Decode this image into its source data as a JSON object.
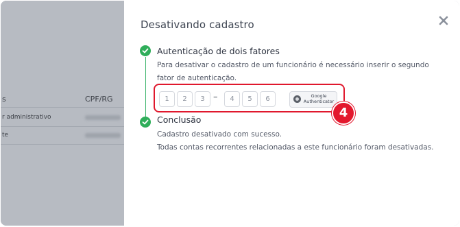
{
  "background": {
    "table": {
      "headers": [
        "s",
        "CPF/RG"
      ],
      "rows": [
        {
          "role": "r administrativo"
        },
        {
          "role": "te"
        }
      ]
    }
  },
  "modal": {
    "title": "Desativando cadastro",
    "close_icon": "close-icon",
    "steps": [
      {
        "title": "Autenticação de dois fatores",
        "description": "Para desativar o cadastro de um funcionário é necessário inserir o segundo fator de autenticação.",
        "status_icon": "check-circle-icon",
        "otp": {
          "digits": [
            "1",
            "2",
            "3",
            "4",
            "5",
            "6"
          ],
          "separator": "–",
          "authenticator_label_line1": "Google",
          "authenticator_label_line2": "Authenticator"
        }
      },
      {
        "title": "Conclusão",
        "status_icon": "check-circle-icon",
        "lines": [
          "Cadastro desativado com sucesso.",
          "Todas contas recorrentes relacionadas a este funcionário foram desativadas."
        ]
      }
    ],
    "annotation_badge": "4"
  },
  "colors": {
    "success": "#2fae5a",
    "highlight": "#e0182d",
    "overlay": "#b7bbc2"
  }
}
